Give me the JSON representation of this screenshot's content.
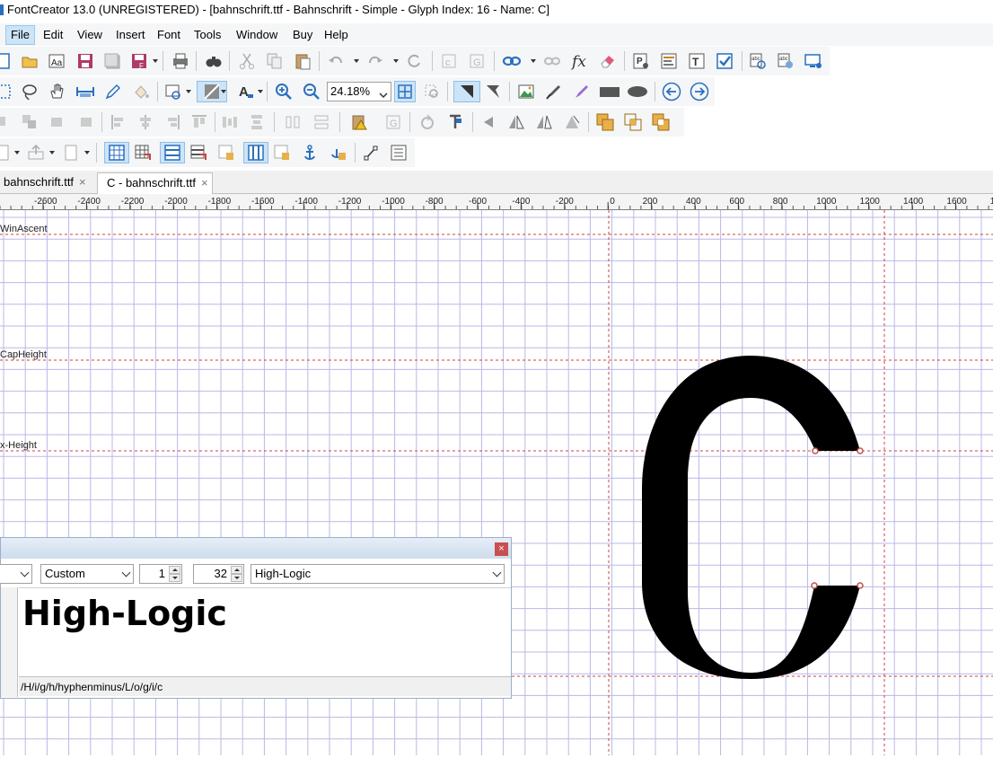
{
  "window": {
    "title": "FontCreator 13.0 (UNREGISTERED) - [bahnschrift.ttf - Bahnschrift - Simple - Glyph Index: 16 - Name: C]"
  },
  "menubar": {
    "items": [
      "File",
      "Edit",
      "View",
      "Insert",
      "Font",
      "Tools",
      "Window",
      "Buy",
      "Help"
    ],
    "active": "File"
  },
  "toolbar": {
    "zoom_value": "24.18%"
  },
  "tabs": [
    {
      "label": "bahnschrift.ttf",
      "close": "×"
    },
    {
      "label": "C - bahnschrift.ttf",
      "close": "×"
    }
  ],
  "ruler": {
    "ticks": [
      "-2600",
      "-2400",
      "-2200",
      "-2000",
      "-1800",
      "-1600",
      "-1400",
      "-1200",
      "-1000",
      "-800",
      "-600",
      "-400",
      "-200",
      "0",
      "200",
      "400",
      "600",
      "800",
      "1000",
      "1200",
      "1400",
      "1600",
      "1"
    ]
  },
  "guidelines": {
    "win_ascent": "WinAscent",
    "cap_height": "CapHeight",
    "x_height": "x-Height"
  },
  "glyph": {
    "name": "C",
    "fill_color": "#000000",
    "point_color": "#c0504d"
  },
  "colors": {
    "grid": "#b8b8e8",
    "guide": "#d04040",
    "selection": "#cce4f7"
  },
  "preview_panel": {
    "close": "×",
    "mode_value": "Custom",
    "spin1_value": "1",
    "spin2_value": "32",
    "text_value": "High-Logic",
    "preview_text": "High-Logic",
    "glyph_sequence": "/H/i/g/h/hyphenminus/L/o/g/i/c"
  }
}
